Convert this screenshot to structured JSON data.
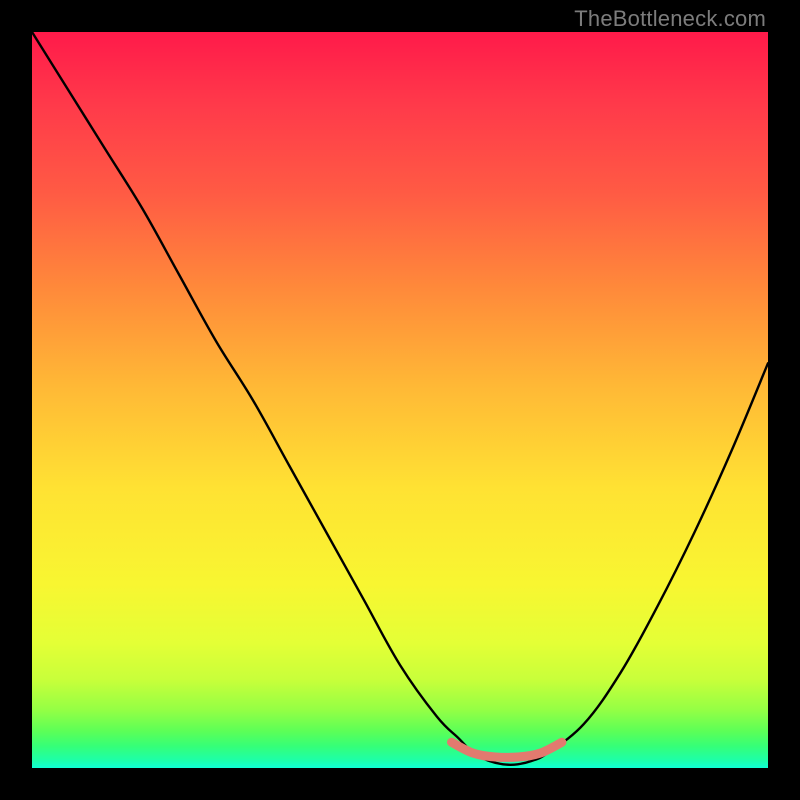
{
  "watermark": "TheBottleneck.com",
  "chart_data": {
    "type": "line",
    "title": "",
    "xlabel": "",
    "ylabel": "",
    "xlim": [
      0,
      100
    ],
    "ylim": [
      0,
      100
    ],
    "grid": false,
    "legend": false,
    "annotations": [],
    "series": [
      {
        "name": "main-curve",
        "color": "#000000",
        "x": [
          0,
          5,
          10,
          15,
          20,
          25,
          30,
          35,
          40,
          45,
          50,
          55,
          58,
          60,
          62,
          64,
          66,
          68,
          70,
          75,
          80,
          85,
          90,
          95,
          100
        ],
        "y": [
          100,
          92,
          84,
          76,
          67,
          58,
          50,
          41,
          32,
          23,
          14,
          7,
          4,
          2,
          1,
          0.5,
          0.5,
          1,
          2,
          6,
          13,
          22,
          32,
          43,
          55
        ]
      },
      {
        "name": "accent-bottom",
        "color": "#e27a6f",
        "x": [
          57,
          60,
          63,
          66,
          69,
          72
        ],
        "y": [
          3.5,
          2,
          1.5,
          1.5,
          2,
          3.5
        ]
      }
    ],
    "gradient_stops": [
      {
        "pos": 0,
        "color": "#ff1a4a"
      },
      {
        "pos": 35,
        "color": "#ff8a3a"
      },
      {
        "pos": 62,
        "color": "#ffe233"
      },
      {
        "pos": 88,
        "color": "#c8ff3a"
      },
      {
        "pos": 100,
        "color": "#10ffd4"
      }
    ]
  }
}
